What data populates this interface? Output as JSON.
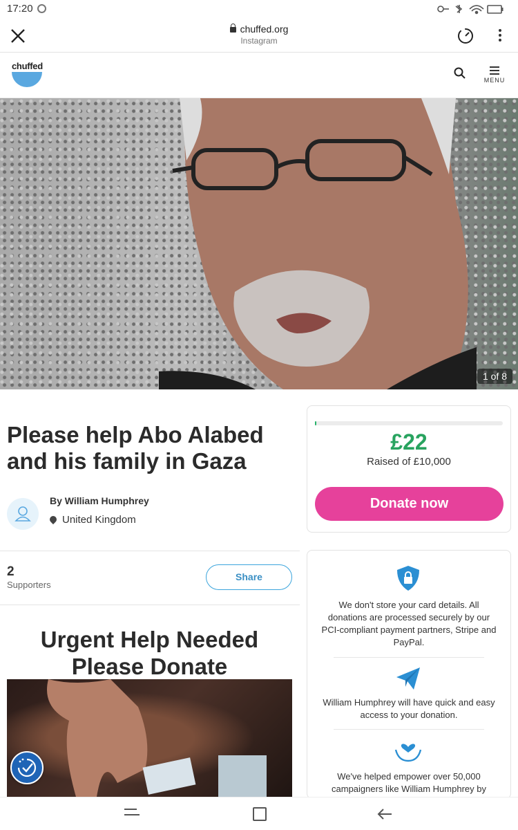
{
  "status_bar": {
    "time": "17:20"
  },
  "browser": {
    "domain": "chuffed.org",
    "source": "Instagram"
  },
  "site_header": {
    "logo": "chuffed",
    "menu_label": "MENU"
  },
  "hero": {
    "counter": "1 of 8"
  },
  "campaign": {
    "title": "Please help Abo Alabed and his family in Gaza",
    "author": "By William Humphrey",
    "location": "United Kingdom",
    "supporters_count": "2",
    "supporters_label": "Supporters",
    "share_label": "Share",
    "story_heading": "Urgent Help Needed Please Donate"
  },
  "donation": {
    "raised": "£22",
    "goal_text": "Raised of £10,000",
    "progress_fraction": 0.0022,
    "donate_label": "Donate now"
  },
  "info": {
    "security_text": "We don't store your card details. All donations are processed securely by our PCI-compliant payment partners, Stripe and PayPal.",
    "access_text": "William Humphrey will have quick and easy access to your donation.",
    "empower_text": "We've helped empower over 50,000 campaigners like William Humphrey by"
  },
  "colors": {
    "accent_blue": "#3aa4dc",
    "donate_pink": "#e6419b",
    "raised_green": "#28a35f"
  }
}
